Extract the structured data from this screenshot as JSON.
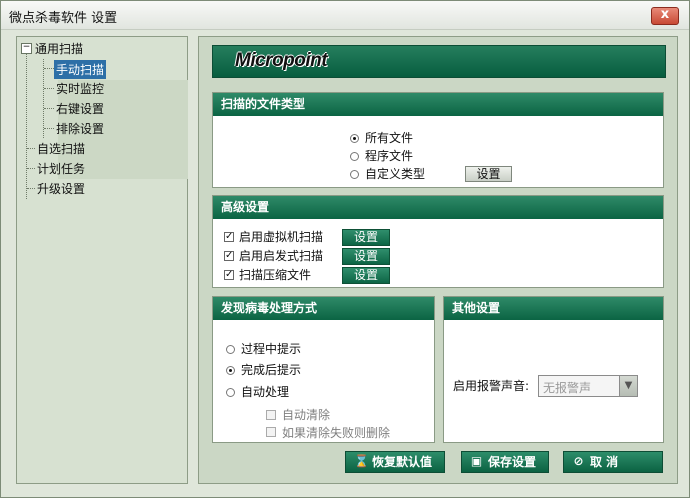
{
  "window": {
    "title": "微点杀毒软件  设置",
    "close_symbol": "x"
  },
  "sidebar": {
    "general": "通用扫描",
    "general_toggle": "−",
    "items": [
      "手动扫描",
      "实时监控",
      "右键设置",
      "排除设置"
    ],
    "custom_scan": "自选扫描",
    "scheduled_tasks": "计划任务",
    "upgrade_settings": "升级设置"
  },
  "banner": {
    "logo": "Micropoint"
  },
  "file_types": {
    "header": "扫描的文件类型",
    "options": [
      "所有文件",
      "程序文件",
      "自定义类型"
    ],
    "selected": 0,
    "settings_button": "设置"
  },
  "advanced": {
    "header": "高级设置",
    "options": [
      "启用虚拟机扫描",
      "启用启发式扫描",
      "扫描压缩文件"
    ],
    "checked_mark": "✓",
    "settings_button": "设置"
  },
  "virus_handling": {
    "header": "发现病毒处理方式",
    "options": [
      "过程中提示",
      "完成后提示",
      "自动处理"
    ],
    "selected": 1,
    "sub_options": [
      "自动清除",
      "如果清除失败则删除"
    ]
  },
  "other": {
    "header": "其他设置",
    "alarm_label": "启用报警声音:",
    "alarm_value": "无报警声"
  },
  "footer": {
    "restore": "恢复默认值",
    "save": "保存设置",
    "cancel": "取  消"
  },
  "colors": {
    "header_green": "#0b6443",
    "selected_blue": "#2d6fa7"
  }
}
